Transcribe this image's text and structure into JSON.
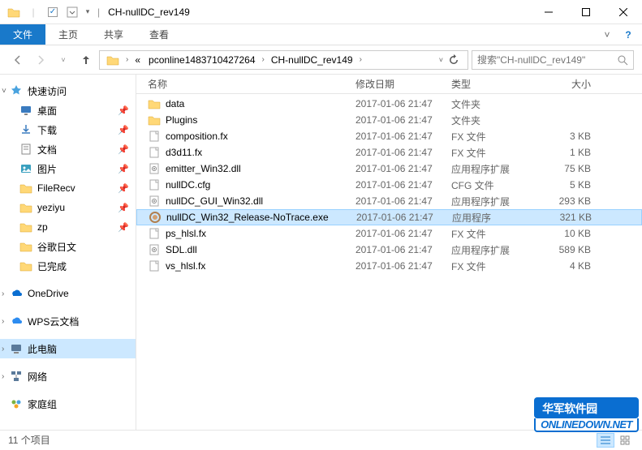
{
  "window": {
    "title": "CH-nullDC_rev149"
  },
  "ribbon": {
    "file": "文件",
    "tabs": [
      "主页",
      "共享",
      "查看"
    ]
  },
  "breadcrumb": {
    "items": [
      "pconline1483710427264",
      "CH-nullDC_rev149"
    ]
  },
  "search": {
    "placeholder": "搜索\"CH-nullDC_rev149\""
  },
  "sidebar": {
    "quick": "快速访问",
    "quick_items": [
      {
        "label": "桌面",
        "pin": true,
        "icon": "desktop"
      },
      {
        "label": "下载",
        "pin": true,
        "icon": "downloads"
      },
      {
        "label": "文档",
        "pin": true,
        "icon": "documents"
      },
      {
        "label": "图片",
        "pin": true,
        "icon": "pictures"
      },
      {
        "label": "FileRecv",
        "pin": true,
        "icon": "folder"
      },
      {
        "label": "yeziyu",
        "pin": true,
        "icon": "folder"
      },
      {
        "label": "zp",
        "pin": true,
        "icon": "folder"
      },
      {
        "label": "谷歌日文",
        "pin": false,
        "icon": "folder"
      },
      {
        "label": "已完成",
        "pin": false,
        "icon": "folder"
      }
    ],
    "onedrive": "OneDrive",
    "wps": "WPS云文档",
    "thispc": "此电脑",
    "network": "网络",
    "homegroup": "家庭组"
  },
  "columns": {
    "name": "名称",
    "date": "修改日期",
    "type": "类型",
    "size": "大小"
  },
  "files": [
    {
      "name": "data",
      "date": "2017-01-06 21:47",
      "type": "文件夹",
      "size": "",
      "icon": "folder",
      "selected": false
    },
    {
      "name": "Plugins",
      "date": "2017-01-06 21:47",
      "type": "文件夹",
      "size": "",
      "icon": "folder",
      "selected": false
    },
    {
      "name": "composition.fx",
      "date": "2017-01-06 21:47",
      "type": "FX 文件",
      "size": "3 KB",
      "icon": "file",
      "selected": false
    },
    {
      "name": "d3d11.fx",
      "date": "2017-01-06 21:47",
      "type": "FX 文件",
      "size": "1 KB",
      "icon": "file",
      "selected": false
    },
    {
      "name": "emitter_Win32.dll",
      "date": "2017-01-06 21:47",
      "type": "应用程序扩展",
      "size": "75 KB",
      "icon": "dll",
      "selected": false
    },
    {
      "name": "nullDC.cfg",
      "date": "2017-01-06 21:47",
      "type": "CFG 文件",
      "size": "5 KB",
      "icon": "file",
      "selected": false
    },
    {
      "name": "nullDC_GUI_Win32.dll",
      "date": "2017-01-06 21:47",
      "type": "应用程序扩展",
      "size": "293 KB",
      "icon": "dll",
      "selected": false
    },
    {
      "name": "nullDC_Win32_Release-NoTrace.exe",
      "date": "2017-01-06 21:47",
      "type": "应用程序",
      "size": "321 KB",
      "icon": "exe",
      "selected": true
    },
    {
      "name": "ps_hlsl.fx",
      "date": "2017-01-06 21:47",
      "type": "FX 文件",
      "size": "10 KB",
      "icon": "file",
      "selected": false
    },
    {
      "name": "SDL.dll",
      "date": "2017-01-06 21:47",
      "type": "应用程序扩展",
      "size": "589 KB",
      "icon": "dll",
      "selected": false
    },
    {
      "name": "vs_hlsl.fx",
      "date": "2017-01-06 21:47",
      "type": "FX 文件",
      "size": "4 KB",
      "icon": "file",
      "selected": false
    }
  ],
  "status": {
    "count": "11 个项目"
  },
  "watermark": {
    "cn": "华军软件园",
    "en": "ONLINEDOWN.NET"
  }
}
